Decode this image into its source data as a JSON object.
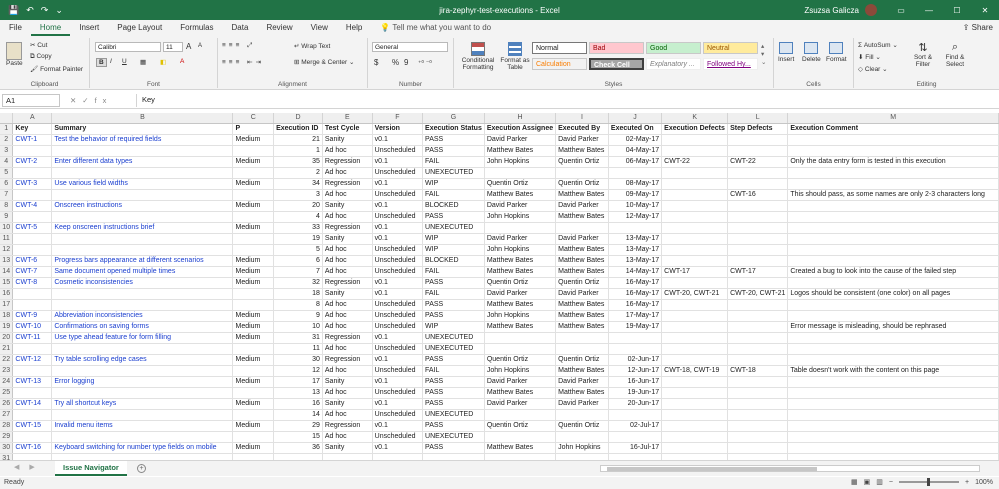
{
  "titlebar": {
    "title": "jira-zephyr-test-executions  -  Excel",
    "user": "Zsuzsa Galicza",
    "qat": {
      "save": "💾",
      "undo": "↶",
      "redo": "↷",
      "customize": "⌄"
    }
  },
  "menu": {
    "tabs": [
      "File",
      "Home",
      "Insert",
      "Page Layout",
      "Formulas",
      "Data",
      "Review",
      "View",
      "Help"
    ],
    "active": "Home",
    "tell_me": "Tell me what you want to do",
    "share": "Share"
  },
  "ribbon": {
    "clipboard": {
      "label": "Clipboard",
      "paste": "Paste",
      "cut": "Cut",
      "copy": "Copy",
      "format_painter": "Format Painter"
    },
    "font": {
      "label": "Font",
      "name": "Calibri",
      "size": "11",
      "bold": "B",
      "italic": "I",
      "underline": "U",
      "grow": "A",
      "shrink": "A"
    },
    "alignment": {
      "label": "Alignment",
      "wrap": "Wrap Text",
      "merge": "Merge & Center"
    },
    "number": {
      "label": "Number",
      "format": "General",
      "currency": "$",
      "percent": "%",
      "comma": "9"
    },
    "styles": {
      "label": "Styles",
      "conditional": "Conditional Formatting",
      "table": "Format as Table",
      "cells": [
        "Normal",
        "Bad",
        "Good",
        "Neutral",
        "Calculation",
        "Check Cell",
        "Explanatory ...",
        "Followed Hy..."
      ]
    },
    "cells": {
      "label": "Cells",
      "insert": "Insert",
      "delete": "Delete",
      "format": "Format"
    },
    "editing": {
      "label": "Editing",
      "autosum": "AutoSum",
      "fill": "Fill",
      "clear": "Clear",
      "sort": "Sort & Filter",
      "find": "Find & Select"
    }
  },
  "formula_bar": {
    "namebox": "A1",
    "fx": "fx",
    "content": "Key"
  },
  "sheet": {
    "columns": [
      "A",
      "B",
      "C",
      "D",
      "E",
      "F",
      "G",
      "H",
      "I",
      "J",
      "K",
      "L",
      "M"
    ],
    "header_row": [
      "Key",
      "Summary",
      "P",
      "Execution ID",
      "Test Cycle",
      "Version",
      "Execution Status",
      "Execution Assignee",
      "Executed By",
      "Executed On",
      "Execution Defects",
      "Step Defects",
      "Execution Comment"
    ],
    "rows": [
      [
        "CWT-1",
        "Test the behavior of required fields",
        "Medium",
        "21",
        "Sanity",
        "v0.1",
        "PASS",
        "David Parker",
        "David Parker",
        "02-May-17",
        "",
        "",
        ""
      ],
      [
        "",
        "",
        "",
        "1",
        "Ad hoc",
        "Unscheduled",
        "PASS",
        "Matthew Bates",
        "Matthew Bates",
        "04-May-17",
        "",
        "",
        ""
      ],
      [
        "CWT-2",
        "Enter different data types",
        "Medium",
        "35",
        "Regression",
        "v0.1",
        "FAIL",
        "John Hopkins",
        "Quentin Ortiz",
        "06-May-17",
        "CWT-22",
        "CWT-22",
        "Only the data entry form is tested in this execution"
      ],
      [
        "",
        "",
        "",
        "2",
        "Ad hoc",
        "Unscheduled",
        "UNEXECUTED",
        "",
        "",
        "",
        "",
        "",
        ""
      ],
      [
        "CWT-3",
        "Use various field widths",
        "Medium",
        "34",
        "Regression",
        "v0.1",
        "WIP",
        "Quentin Ortiz",
        "Quentin Ortiz",
        "08-May-17",
        "",
        "",
        ""
      ],
      [
        "",
        "",
        "",
        "3",
        "Ad hoc",
        "Unscheduled",
        "FAIL",
        "Matthew Bates",
        "Matthew Bates",
        "09-May-17",
        "",
        "CWT-16",
        "This should pass, as some names are only 2-3 characters long"
      ],
      [
        "CWT-4",
        "Onscreen instructions",
        "Medium",
        "20",
        "Sanity",
        "v0.1",
        "BLOCKED",
        "David Parker",
        "David Parker",
        "10-May-17",
        "",
        "",
        ""
      ],
      [
        "",
        "",
        "",
        "4",
        "Ad hoc",
        "Unscheduled",
        "PASS",
        "John Hopkins",
        "Matthew Bates",
        "12-May-17",
        "",
        "",
        ""
      ],
      [
        "CWT-5",
        "Keep onscreen instructions brief",
        "Medium",
        "33",
        "Regression",
        "v0.1",
        "UNEXECUTED",
        "",
        "",
        "",
        "",
        "",
        ""
      ],
      [
        "",
        "",
        "",
        "19",
        "Sanity",
        "v0.1",
        "WIP",
        "David Parker",
        "David Parker",
        "13-May-17",
        "",
        "",
        ""
      ],
      [
        "",
        "",
        "",
        "5",
        "Ad hoc",
        "Unscheduled",
        "WIP",
        "John Hopkins",
        "Matthew Bates",
        "13-May-17",
        "",
        "",
        ""
      ],
      [
        "CWT-6",
        "Progress bars appearance at different scenarios",
        "Medium",
        "6",
        "Ad hoc",
        "Unscheduled",
        "BLOCKED",
        "Matthew Bates",
        "Matthew Bates",
        "13-May-17",
        "",
        "",
        ""
      ],
      [
        "CWT-7",
        "Same document opened multiple times",
        "Medium",
        "7",
        "Ad hoc",
        "Unscheduled",
        "FAIL",
        "Matthew Bates",
        "Matthew Bates",
        "14-May-17",
        "CWT-17",
        "CWT-17",
        "Created a bug to look into the cause of the failed step"
      ],
      [
        "CWT-8",
        "Cosmetic inconsistencies",
        "Medium",
        "32",
        "Regression",
        "v0.1",
        "PASS",
        "Quentin Ortiz",
        "Quentin Ortiz",
        "16-May-17",
        "",
        "",
        ""
      ],
      [
        "",
        "",
        "",
        "18",
        "Sanity",
        "v0.1",
        "FAIL",
        "David Parker",
        "David Parker",
        "16-May-17",
        "CWT-20, CWT-21",
        "CWT-20, CWT-21",
        "Logos should be consistent (one color) on all pages"
      ],
      [
        "",
        "",
        "",
        "8",
        "Ad hoc",
        "Unscheduled",
        "PASS",
        "Matthew Bates",
        "Matthew Bates",
        "16-May-17",
        "",
        "",
        ""
      ],
      [
        "CWT-9",
        "Abbreviation inconsistencies",
        "Medium",
        "9",
        "Ad hoc",
        "Unscheduled",
        "PASS",
        "John Hopkins",
        "Matthew Bates",
        "17-May-17",
        "",
        "",
        ""
      ],
      [
        "CWT-10",
        "Confirmations on saving forms",
        "Medium",
        "10",
        "Ad hoc",
        "Unscheduled",
        "WIP",
        "Matthew Bates",
        "Matthew Bates",
        "19-May-17",
        "",
        "",
        "Error message is misleading,  should be rephrased"
      ],
      [
        "CWT-11",
        "Use type ahead feature for form filling",
        "Medium",
        "31",
        "Regression",
        "v0.1",
        "UNEXECUTED",
        "",
        "",
        "",
        "",
        "",
        ""
      ],
      [
        "",
        "",
        "",
        "11",
        "Ad hoc",
        "Unscheduled",
        "UNEXECUTED",
        "",
        "",
        "",
        "",
        "",
        ""
      ],
      [
        "CWT-12",
        "Try table scrolling edge cases",
        "Medium",
        "30",
        "Regression",
        "v0.1",
        "PASS",
        "Quentin Ortiz",
        "Quentin Ortiz",
        "02-Jun-17",
        "",
        "",
        ""
      ],
      [
        "",
        "",
        "",
        "12",
        "Ad hoc",
        "Unscheduled",
        "FAIL",
        "John Hopkins",
        "Matthew Bates",
        "12-Jun-17",
        "CWT-18, CWT-19",
        "CWT-18",
        "Table doesn't work with the content on this page"
      ],
      [
        "CWT-13",
        "Error logging",
        "Medium",
        "17",
        "Sanity",
        "v0.1",
        "PASS",
        "David Parker",
        "David Parker",
        "16-Jun-17",
        "",
        "",
        ""
      ],
      [
        "",
        "",
        "",
        "13",
        "Ad hoc",
        "Unscheduled",
        "PASS",
        "Matthew Bates",
        "Matthew Bates",
        "19-Jun-17",
        "",
        "",
        ""
      ],
      [
        "CWT-14",
        "Try all shortcut keys",
        "Medium",
        "16",
        "Sanity",
        "v0.1",
        "PASS",
        "David Parker",
        "David Parker",
        "20-Jun-17",
        "",
        "",
        ""
      ],
      [
        "",
        "",
        "",
        "14",
        "Ad hoc",
        "Unscheduled",
        "UNEXECUTED",
        "",
        "",
        "",
        "",
        "",
        ""
      ],
      [
        "CWT-15",
        "Invalid menu items",
        "Medium",
        "29",
        "Regression",
        "v0.1",
        "PASS",
        "Quentin Ortiz",
        "Quentin Ortiz",
        "02-Jul-17",
        "",
        "",
        ""
      ],
      [
        "",
        "",
        "",
        "15",
        "Ad hoc",
        "Unscheduled",
        "UNEXECUTED",
        "",
        "",
        "",
        "",
        "",
        ""
      ],
      [
        "CWT-16",
        "Keyboard switching for number type fields on mobile",
        "Medium",
        "36",
        "Sanity",
        "v0.1",
        "PASS",
        "Matthew Bates",
        "John Hopkins",
        "16-Jul-17",
        "",
        "",
        ""
      ],
      [
        "",
        "",
        "",
        "",
        "",
        "",
        "",
        "",
        "",
        "",
        "",
        "",
        ""
      ]
    ]
  },
  "sheet_tabs": {
    "active": "Issue Navigator",
    "add": "+"
  },
  "status": {
    "ready": "Ready",
    "zoom": "100%"
  },
  "colors": {
    "accent": "#217346",
    "link": "#1a3ecf",
    "bad_bg": "#ffc7ce",
    "good_bg": "#c6efce",
    "neutral_bg": "#ffeb9c",
    "check_bg": "#a5a5a5"
  }
}
